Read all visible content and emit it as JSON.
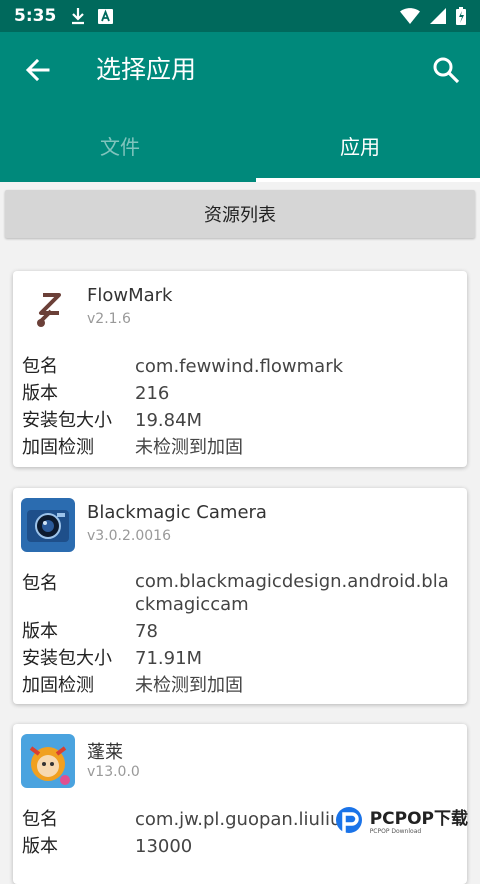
{
  "status_bar": {
    "time": "5:35"
  },
  "appbar": {
    "title": "选择应用"
  },
  "tabs": [
    {
      "label": "文件"
    },
    {
      "label": "应用"
    }
  ],
  "resource_button": {
    "label": "资源列表"
  },
  "fields": {
    "package": "包名",
    "version": "版本",
    "size": "安装包大小",
    "hardening": "加固检测"
  },
  "apps": [
    {
      "name": "FlowMark",
      "version": "v2.1.6",
      "package": "com.fewwind.flowmark",
      "version_code": "216",
      "size": "19.84M",
      "hardening": "未检测到加固"
    },
    {
      "name": "Blackmagic Camera",
      "version": "v3.0.2.0016",
      "package": "com.blackmagicdesign.android.blackmagiccam",
      "version_code": "78",
      "size": "71.91M",
      "hardening": "未检测到加固"
    },
    {
      "name": "蓬莱",
      "version": "v13.0.0",
      "package": "com.jw.pl.guopan.liuliu",
      "version_code": "13000"
    }
  ],
  "watermark": {
    "text": "PCPOP下载",
    "sub": "PCPOP Download"
  }
}
